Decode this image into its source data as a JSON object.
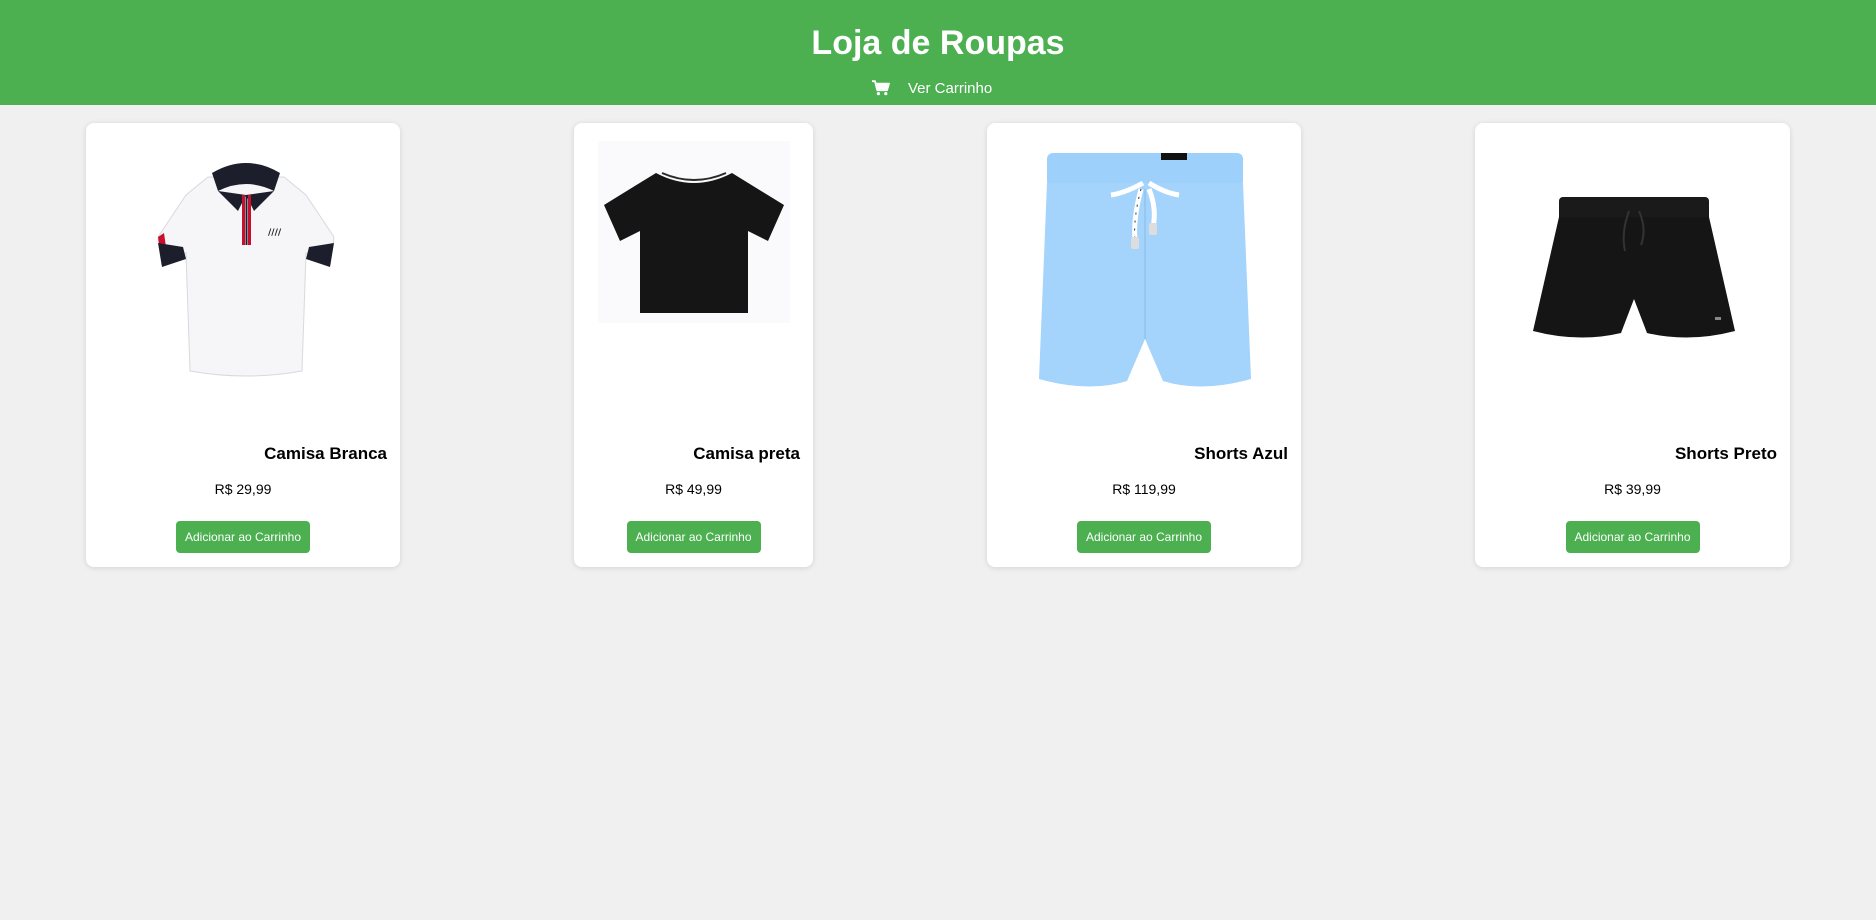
{
  "header": {
    "title": "Loja de Roupas",
    "cart_icon": "shopping-cart-icon",
    "cart_label": "Ver Carrinho",
    "bg_color": "#4caf50"
  },
  "products": [
    {
      "name": "Camisa Branca",
      "price": "R$ 29,99",
      "button_label": "Adicionar ao Carrinho",
      "image": "white-polo-shirt"
    },
    {
      "name": "Camisa preta",
      "price": "R$ 49,99",
      "button_label": "Adicionar ao Carrinho",
      "image": "black-t-shirt"
    },
    {
      "name": "Shorts Azul",
      "price": "R$ 119,99",
      "button_label": "Adicionar ao Carrinho",
      "image": "light-blue-swim-shorts"
    },
    {
      "name": "Shorts Preto",
      "price": "R$ 39,99",
      "button_label": "Adicionar ao Carrinho",
      "image": "black-shorts"
    }
  ],
  "colors": {
    "accent": "#4caf50",
    "page_bg": "#f0f0f0",
    "card_bg": "#ffffff"
  }
}
